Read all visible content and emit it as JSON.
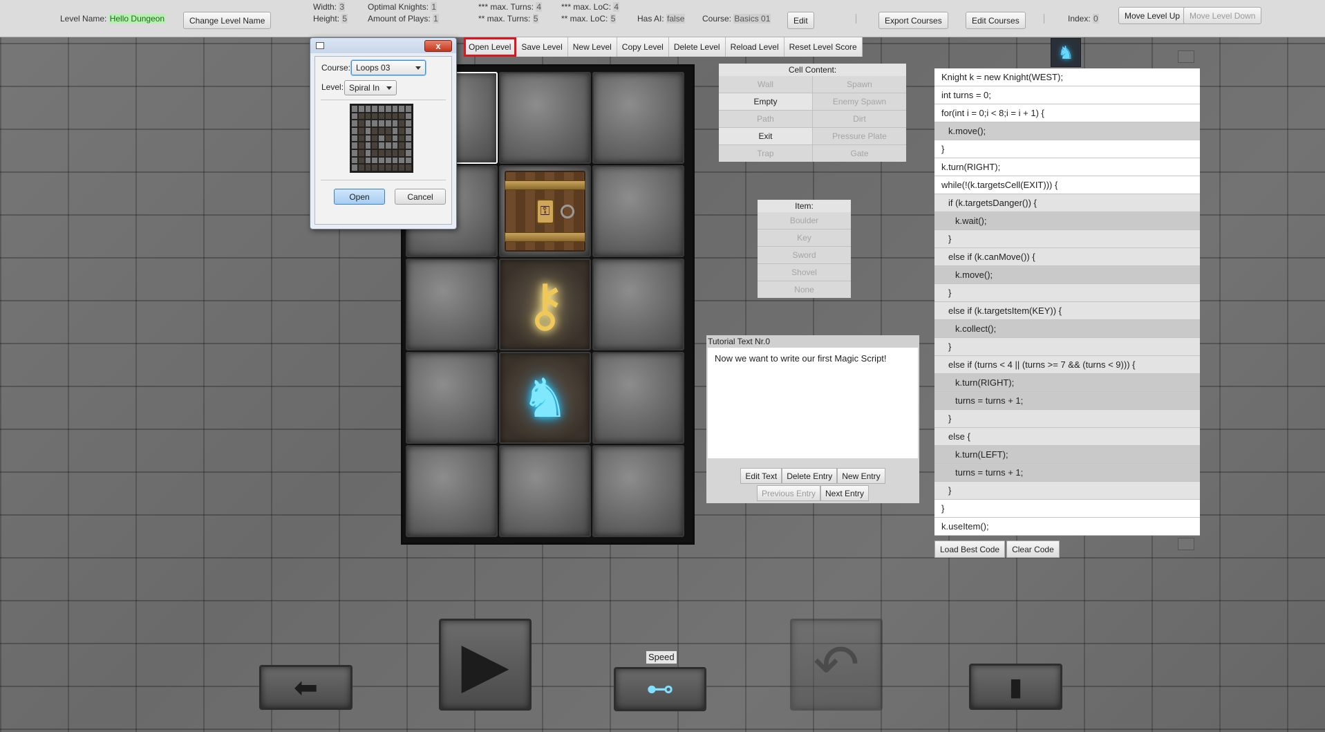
{
  "toolbar": {
    "level_name_label": "Level Name:",
    "level_name_value": "Hello Dungeon",
    "change_level_name": "Change Level Name",
    "width_label": "Width:",
    "width_value": "3",
    "height_label": "Height:",
    "height_value": "5",
    "optimal_knights_label": "Optimal Knights:",
    "optimal_knights_value": "1",
    "amount_of_plays_label": "Amount of Plays:",
    "amount_of_plays_value": "1",
    "max_turns_3_label": "*** max. Turns:",
    "max_turns_3_value": "4",
    "max_turns_2_label": "** max. Turns:",
    "max_turns_2_value": "5",
    "max_loc_3_label": "*** max. LoC:",
    "max_loc_3_value": "4",
    "max_loc_2_label": "** max. LoC:",
    "max_loc_2_value": "5",
    "has_ai_label": "Has AI:",
    "has_ai_value": "false",
    "course_label": "Course:",
    "course_value": "Basics 01",
    "edit": "Edit",
    "export_courses": "Export Courses",
    "edit_courses": "Edit Courses",
    "index_label": "Index:",
    "index_value": "0",
    "move_level_up": "Move Level Up",
    "move_level_down": "Move Level Down"
  },
  "level_buttons": [
    "Open Level",
    "Save Level",
    "New Level",
    "Copy Level",
    "Delete Level",
    "Reload Level",
    "Reset Level Score"
  ],
  "dialog": {
    "close_glyph": "x",
    "course_label": "Course:",
    "course_value": "Loops 03",
    "level_label": "Level:",
    "level_value": "Spiral In",
    "open": "Open",
    "cancel": "Cancel"
  },
  "cell_content": {
    "title": "Cell Content:",
    "items": [
      {
        "label": "Wall",
        "enabled": false
      },
      {
        "label": "Spawn",
        "enabled": false
      },
      {
        "label": "Empty",
        "enabled": true
      },
      {
        "label": "Enemy Spawn",
        "enabled": false
      },
      {
        "label": "Path",
        "enabled": false
      },
      {
        "label": "Dirt",
        "enabled": false
      },
      {
        "label": "Exit",
        "enabled": true
      },
      {
        "label": "Pressure Plate",
        "enabled": false
      },
      {
        "label": "Trap",
        "enabled": false
      },
      {
        "label": "Gate",
        "enabled": false
      }
    ]
  },
  "item_panel": {
    "title": "Item:",
    "items": [
      "Boulder",
      "Key",
      "Sword",
      "Shovel",
      "None"
    ]
  },
  "tutorial": {
    "title": "Tutorial Text Nr.0",
    "text": "Now we want to write our first Magic Script!",
    "edit_text": "Edit Text",
    "delete_entry": "Delete Entry",
    "new_entry": "New Entry",
    "previous_entry": "Previous Entry",
    "next_entry": "Next Entry"
  },
  "code": {
    "lines": [
      {
        "text": "Knight k = new Knight(WEST);",
        "indent": 0
      },
      {
        "text": "int turns = 0;",
        "indent": 0
      },
      {
        "text": "for(int i = 0;i < 8;i = i + 1) {",
        "indent": 0
      },
      {
        "text": "k.move();",
        "indent": 1
      },
      {
        "text": "}",
        "indent": 0
      },
      {
        "text": "k.turn(RIGHT);",
        "indent": 0
      },
      {
        "text": "while(!(k.targetsCell(EXIT))) {",
        "indent": 0
      },
      {
        "text": "if (k.targetsDanger()) {",
        "indent": 1
      },
      {
        "text": "k.wait();",
        "indent": 2
      },
      {
        "text": "}",
        "indent": 1
      },
      {
        "text": "else if (k.canMove()) {",
        "indent": 1
      },
      {
        "text": "k.move();",
        "indent": 2
      },
      {
        "text": "}",
        "indent": 1
      },
      {
        "text": "else if (k.targetsItem(KEY)) {",
        "indent": 1
      },
      {
        "text": "k.collect();",
        "indent": 2
      },
      {
        "text": "}",
        "indent": 1
      },
      {
        "text": "else if (turns < 4 || (turns >= 7 && (turns < 9))) {",
        "indent": 1
      },
      {
        "text": "k.turn(RIGHT);",
        "indent": 2
      },
      {
        "text": "turns = turns + 1;",
        "indent": 2
      },
      {
        "text": "}",
        "indent": 1
      },
      {
        "text": "else {",
        "indent": 1
      },
      {
        "text": "k.turn(LEFT);",
        "indent": 2
      },
      {
        "text": "turns = turns + 1;",
        "indent": 2
      },
      {
        "text": "}",
        "indent": 1
      },
      {
        "text": "}",
        "indent": 0
      },
      {
        "text": "k.useItem();",
        "indent": 0
      }
    ],
    "load_best_code": "Load Best Code",
    "clear_code": "Clear Code"
  },
  "grid": {
    "cols": 3,
    "rows": 5,
    "cells": [
      "wall-selected",
      "wall",
      "wall",
      "wall",
      "exit-door",
      "wall",
      "wall",
      "key",
      "wall",
      "wall",
      "knight",
      "wall",
      "wall",
      "wall",
      "wall"
    ]
  },
  "icons": {
    "key": "⚷",
    "knight": "♞",
    "play": "▶",
    "back": "⬅",
    "undo": "↶",
    "book": "▮",
    "speed": "⊷"
  },
  "speed_label": "Speed"
}
